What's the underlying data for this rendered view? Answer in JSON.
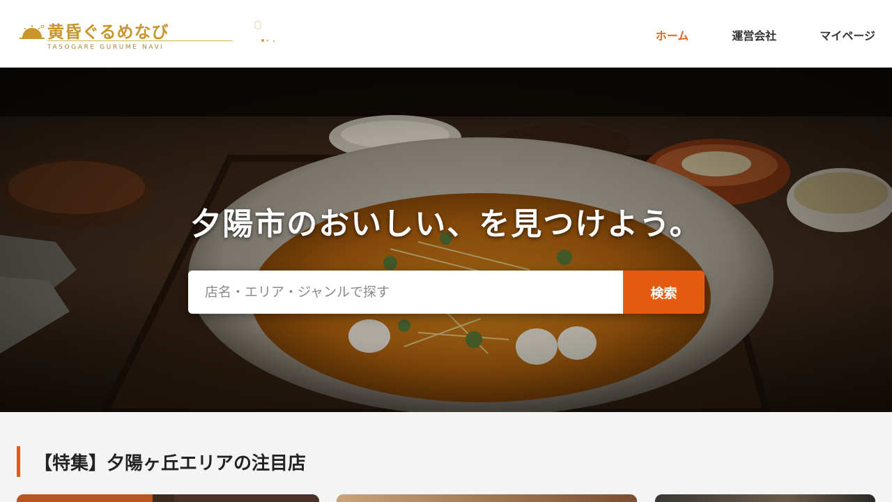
{
  "brand": {
    "title": "黄昏ぐるめなび",
    "subtitle": "TASOGARE GURUME NAVI",
    "accent": "#c9962c"
  },
  "nav": {
    "items": [
      {
        "label": "ホーム",
        "active": true
      },
      {
        "label": "運営会社",
        "active": false
      },
      {
        "label": "マイページ",
        "active": false
      }
    ],
    "active_color": "#e8631a"
  },
  "hero": {
    "headline": "夕陽市のおいしい、を見つけよう。",
    "search": {
      "placeholder": "店名・エリア・ジャンルで探す",
      "value": "",
      "button_label": "検索"
    },
    "button_color": "#e35a10"
  },
  "featured": {
    "heading": "【特集】夕陽ヶ丘エリアの注目店"
  }
}
